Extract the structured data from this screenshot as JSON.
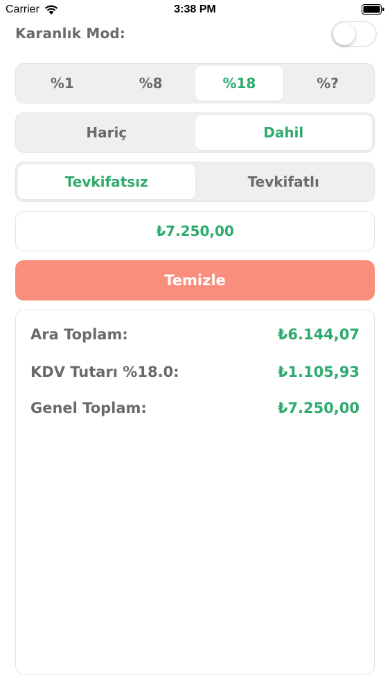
{
  "status_bar": {
    "carrier": "Carrier",
    "time": "3:38 PM",
    "wifi_icon": "wifi-icon",
    "battery_icon": "battery-icon"
  },
  "dark_mode": {
    "label": "Karanlık Mod:",
    "enabled": false
  },
  "rate_options": [
    "%1",
    "%8",
    "%18",
    "%?"
  ],
  "rate_selected": "%18",
  "kdv_options": [
    "Hariç",
    "Dahil"
  ],
  "kdv_selected": "Dahil",
  "tevkifat_options": [
    "Tevkifatsız",
    "Tevkifatlı"
  ],
  "tevkifat_selected": "Tevkifatsız",
  "amount": "₺7.250,00",
  "clear_button": "Temizle",
  "results": {
    "subtotal_label": "Ara Toplam:",
    "subtotal_value": "₺6.144,07",
    "kdv_label": "KDV Tutarı %18.0:",
    "kdv_value": "₺1.105,93",
    "total_label": "Genel Toplam:",
    "total_value": "₺7.250,00"
  },
  "colors": {
    "accent_green": "#2eaa6e",
    "clear_button": "#f98e7c",
    "segment_background": "#efeff0"
  }
}
